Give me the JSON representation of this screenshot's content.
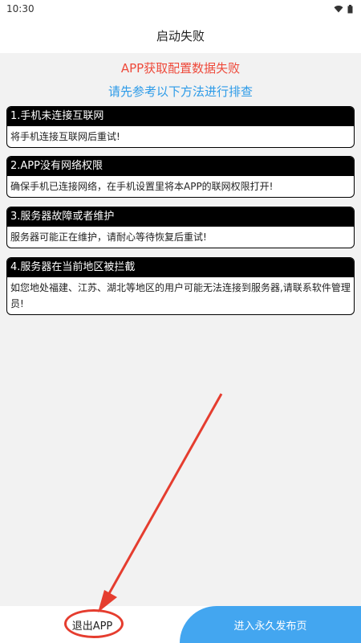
{
  "status_bar": {
    "time": "10:30",
    "icons": [
      "wifi-icon",
      "battery-icon"
    ]
  },
  "app_bar": {
    "title": "启动失败"
  },
  "content": {
    "error_title": "APP获取配置数据失败",
    "hint_title": "请先参考以下方法进行排查",
    "cards": [
      {
        "title": "1.手机未连接互联网",
        "body": "将手机连接互联网后重试!"
      },
      {
        "title": "2.APP没有网络权限",
        "body": "确保手机已连接网络，在手机设置里将本APP的联网权限打开!"
      },
      {
        "title": "3.服务器故障或者维护",
        "body": "服务器可能正在维护，请耐心等待恢复后重试!"
      },
      {
        "title": "4.服务器在当前地区被拦截",
        "body": "如您地处福建、江苏、湖北等地区的用户可能无法连接到服务器,请联系软件管理员!"
      }
    ]
  },
  "bottom_bar": {
    "exit_label": "退出APP",
    "publish_label": "进入永久发布页"
  },
  "colors": {
    "error": "#ee4a3b",
    "hint": "#2d9be8",
    "primary_button": "#43a6f0",
    "annotation": "#e53d2f"
  }
}
